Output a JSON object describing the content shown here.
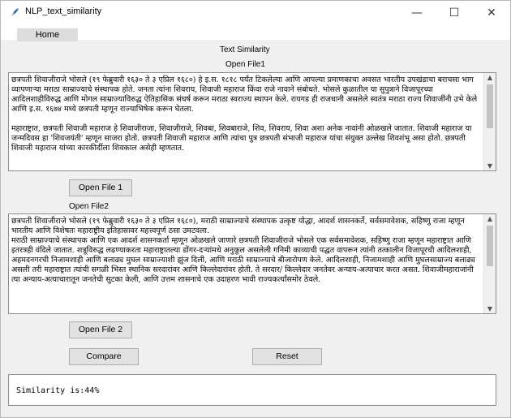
{
  "window": {
    "title": "NLP_text_similarity",
    "minimize_glyph": "—",
    "maximize_glyph": "☐",
    "close_glyph": "✕"
  },
  "menu": {
    "home": "Home"
  },
  "labels": {
    "heading": "Text Similarity",
    "open_file1": "Open File1",
    "open_file2": "Open File2"
  },
  "text1": "छत्रपती शिवाजीराजे भोसले (१९ फेब्रुवारी १६३० ते ३ एप्रिल १६८०) हे इ.स. १८१८ पर्यंत टिकलेल्या आणि आपल्या प्रमाणकाचा अवसत भारतीय उपखंडाचा बराचसा भाग व्यापणाऱ्या मराठा साम्राज्याचे संस्थापक होते. जनता त्यांना शिवराय, शिवाजी महाराज किंवा राजे नावाने संबोधते. भोसले कुळातील या सुपुत्राने विजापूरच्या आदिलशाहीविरुद्ध आणि मोगल साम्राज्याविरुद्ध ऐतिहासिक संघर्ष करून मराठा स्वराज्य स्थापन केले. रायगड ही राजधानी असलेले स्वतंत्र मराठा राज्य शिवाजींनी उभे केले आणि इ.स. १६७४ मध्ये छत्रपती म्हणून राज्याभिषेक करून घेतला.\n\nमहाराष्ट्रात, छत्रपती शिवाजी महाराज हे शिवाजीराजा, शिवाजीराजे, शिवबा, शिवबाराजे, शिव, शिवराय, शिवा अशा अनेक नावांनी ओळखले जातात. शिवाजी महाराज या जन्मदिवस हा 'शिवजयंती' म्हणून साजरा होतो. छत्रपती शिवाजी महाराज आणि त्यांचा पुत्र छत्रपती संभाजी महाराज यांचा संयुक्त उल्लेख शिवशंभू असा होतो. छत्रपती शिवाजी महाराज यांच्या कारकीर्दीला शिवकाल असेही म्हणतात.",
  "text2": "छत्रपती शिवाजीराजे भोसले (१९ फेब्रुवारी १६३० ते ३ एप्रिल १६८०), मराठी साम्राज्याचे संस्थापक उत्कृष्ट योद्धा, आदर्श शासनकर्ते, सर्वसमावेशक, सहिष्णु राजा म्हणून भारतीय आणि विशेषतः महाराष्ट्रीय इतिहासावर महत्त्वपूर्ण ठसा उमटवला.\nमराठी साम्राज्याचे संस्थापक आणि एक आदर्श शासनकर्ता म्हणून ओळखले जाणारे छत्रपती शिवाजीराजे भोसले एक सर्वसमावेशक, सहिष्णु राजा म्हणून महाराष्ट्रात आणि इतरत्रही वंदिले जातात. शत्रूविरुद्ध लढण्याकरता महाराष्ट्रातल्या डोंगर-दऱ्यांमधे अनुकूल असलेली गनिमी काव्याची पद्धत वापरून त्यांनी तत्कालीन विजापूरची आदिलशाही, अहमदनगरची निजामशाही आणि बलाढ्य मुघल साम्राज्याशी झुंज दिली, आणि मराठी साम्राज्याचे बीजारोपण केले. आदिलशाही, निजामशाही आणि मुघलसाम्राज्य बलाढ्य असली तरी महाराष्ट्रात त्यांची सगळी भिस्त स्थानिक सरदारांवर आणि किल्लेदारांवर होती. ते सरदार/ किल्लेदार जनतेवर अन्याय-अत्याचार करत असत. शिवाजीमहाराजांनी त्या अन्याय-अत्याचारातून जनतेची सुटका केली, आणि उत्तम शासनाचे एक उदाहरण भावी राज्यकर्त्यांसमोर ठेवले.",
  "buttons": {
    "open_file1": "Open File 1",
    "open_file2": "Open File 2",
    "compare": "Compare",
    "reset": "Reset"
  },
  "result": "Similarity is:44%"
}
